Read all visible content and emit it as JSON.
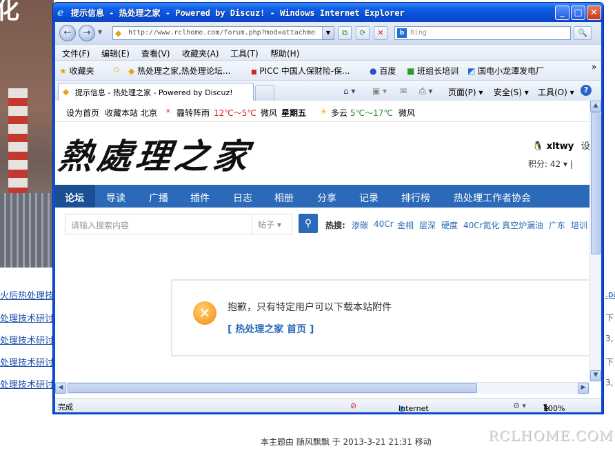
{
  "background": {
    "links": [
      "火后热处理技",
      "处理技术研讨",
      "处理技术研讨",
      "处理技术研讨",
      "处理技术研讨"
    ],
    "right_texts": [
      ".pa",
      "下",
      "3, 7",
      "下",
      "3, 7"
    ],
    "moved_note": "本主题由 随风飘飘 于 2013-3-21 21:31 移动",
    "watermark": "RCLHOME.COM",
    "title_fragment": "化 "
  },
  "window": {
    "title": "提示信息 - 热处理之家 - Powered by Discuz! - Windows Internet Explorer",
    "min": "_",
    "max": "□",
    "close": "✕"
  },
  "navbar": {
    "back": "←",
    "forward": "→",
    "url": "http://www.rclhome.com/forum.php?mod=attachment",
    "search_placeholder": "Bing",
    "search_btn": "🔍"
  },
  "menu": [
    "文件(F)",
    "编辑(E)",
    "查看(V)",
    "收藏夹(A)",
    "工具(T)",
    "帮助(H)"
  ],
  "favorites": {
    "label": "收藏夹",
    "items": [
      "热处理之家,热处理论坛...",
      "PICC 中国人保财险-保...",
      "百度",
      "班组长培训",
      "国电小龙潭发电厂"
    ],
    "more": "»"
  },
  "tabs": {
    "active": "提示信息 - 热处理之家 - Powered by Discuz!",
    "page": "页面(P)",
    "safety": "安全(S)",
    "tools": "工具(O)",
    "help": "?"
  },
  "site": {
    "weather": {
      "home": "设为首页",
      "fav": "收藏本站",
      "city": "北京",
      "today_cond": "霾转阵雨",
      "today_temp": "12℃～5℃",
      "today_wind": "微风",
      "weekday": "星期五",
      "tomorrow_cond": "多云",
      "tomorrow_temp": "5℃～17℃",
      "tomorrow_wind": "微风"
    },
    "logo": "熱處理之家",
    "user": "xltwy",
    "user_extra": "设",
    "score": "积分: 42 ▾   |",
    "nav": [
      "论坛",
      "导读",
      "广播",
      "插件",
      "日志",
      "相册",
      "分享",
      "记录",
      "排行榜",
      "热处理工作者协会"
    ],
    "search_placeholder": "请输入搜索内容",
    "search_type": "帖子 ▾",
    "hot_label": "热搜:",
    "hot": [
      "渗碳",
      "40Cr",
      "金相",
      "层深",
      "硬度",
      "40Cr氮化",
      "真空炉漏油",
      "广东",
      "培训"
    ],
    "message": "抱歉，只有特定用户可以下载本站附件",
    "home_link": "[ 热处理之家 首页 ]"
  },
  "status": {
    "text": "完成",
    "zone": "Internet",
    "zoom": "100%"
  },
  "colors": {
    "accent": "#2b6ab8",
    "title_bar": "#0a4ad0",
    "warning": "#f08a14"
  }
}
